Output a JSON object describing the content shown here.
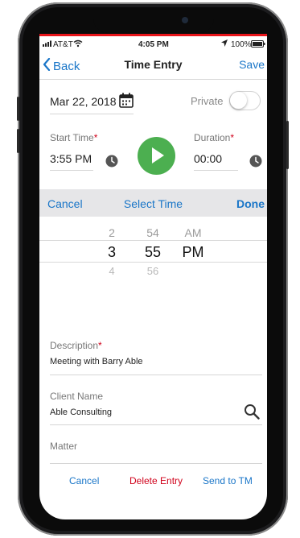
{
  "status_bar": {
    "carrier": "AT&T",
    "time": "4:05 PM",
    "battery": "100%"
  },
  "nav": {
    "back_label": "Back",
    "title": "Time Entry",
    "save_label": "Save"
  },
  "form": {
    "date": "Mar 22, 2018",
    "private_label": "Private",
    "private_on": false,
    "start_time_label": "Start Time",
    "start_time_value": "3:55 PM",
    "duration_label": "Duration",
    "duration_value": "00:00",
    "required_marker": "*"
  },
  "picker": {
    "cancel_label": "Cancel",
    "title": "Select Time",
    "done_label": "Done",
    "hours": [
      "2",
      "3",
      "4"
    ],
    "minutes": [
      "54",
      "55",
      "56"
    ],
    "ampm": [
      "AM",
      "PM"
    ]
  },
  "fields": {
    "description_label": "Description",
    "description_value": "Meeting with Barry Able",
    "client_label": "Client Name",
    "client_value": "Able Consulting",
    "matter_label": "Matter"
  },
  "footer": {
    "cancel_label": "Cancel",
    "delete_label": "Delete Entry",
    "send_label": "Send to TM"
  },
  "colors": {
    "accent": "#1a76c8",
    "danger": "#d0021b",
    "play": "#4caf50",
    "status_bar": "#e8141a"
  }
}
